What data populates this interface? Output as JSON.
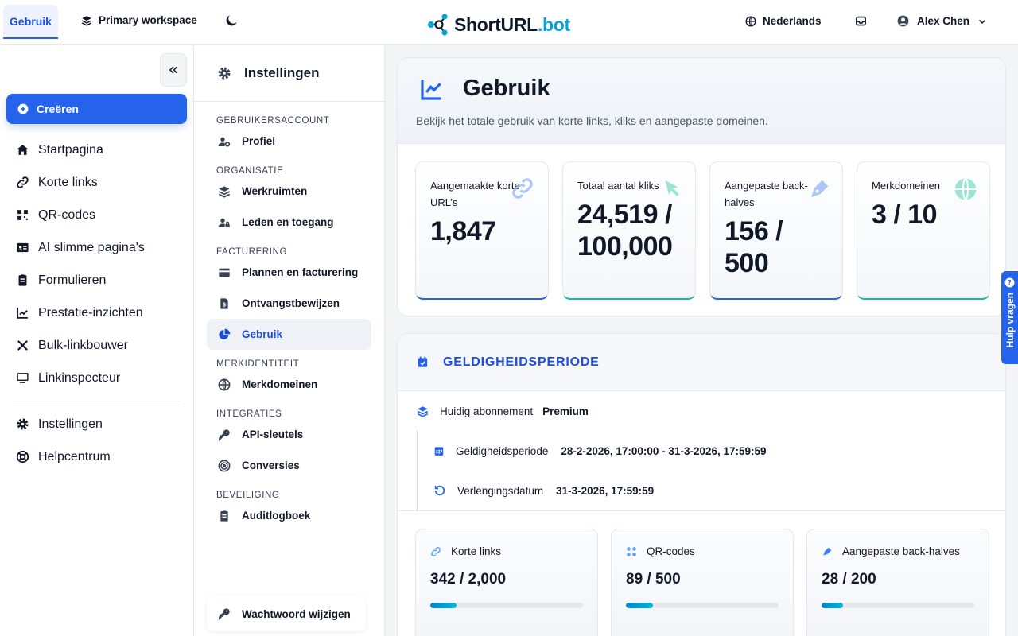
{
  "topbar": {
    "active_tab": "Gebruik",
    "workspace": "Primary workspace",
    "logo_main": "ShortURL",
    "logo_suffix": ".bot",
    "language": "Nederlands",
    "user_name": "Alex Chen"
  },
  "sidebar": {
    "create_label": "Creëren",
    "items": [
      {
        "label": "Startpagina",
        "icon": "home-icon"
      },
      {
        "label": "Korte links",
        "icon": "link-icon"
      },
      {
        "label": "QR-codes",
        "icon": "qr-icon"
      },
      {
        "label": "AI slimme pagina's",
        "icon": "id-card-icon"
      },
      {
        "label": "Formulieren",
        "icon": "clipboard-icon"
      },
      {
        "label": "Prestatie-inzichten",
        "icon": "chart-line-icon"
      },
      {
        "label": "Bulk-linkbouwer",
        "icon": "tools-icon"
      },
      {
        "label": "Linkinspecteur",
        "icon": "monitor-icon"
      }
    ],
    "bottom_items": [
      {
        "label": "Instellingen",
        "icon": "gear-icon"
      },
      {
        "label": "Helpcentrum",
        "icon": "lifebuoy-icon"
      }
    ]
  },
  "settings_nav": {
    "title": "Instellingen",
    "sections": [
      {
        "title": "GEBRUIKERSACCOUNT",
        "items": [
          "Profiel"
        ]
      },
      {
        "title": "ORGANISATIE",
        "items": [
          "Werkruimten",
          "Leden en toegang"
        ]
      },
      {
        "title": "FACTURERING",
        "items": [
          "Plannen en facturering",
          "Ontvangstbewijzen",
          "Gebruik"
        ]
      },
      {
        "title": "MERKIDENTITEIT",
        "items": [
          "Merkdomeinen"
        ]
      },
      {
        "title": "INTEGRATIES",
        "items": [
          "API-sleutels",
          "Conversies"
        ]
      },
      {
        "title": "BEVEILIGING",
        "items": [
          "Auditlogboek"
        ]
      }
    ],
    "active_item": "Gebruik",
    "change_password": "Wachtwoord wijzigen"
  },
  "usage": {
    "title": "Gebruik",
    "subtitle": "Bekijk het totale gebruik van korte links, kliks en aangepaste domeinen.",
    "stats": [
      {
        "label": "Aangemaakte korte URL’s",
        "value": "1,847",
        "accent": "#2563eb",
        "icon": "link-icon"
      },
      {
        "label": "Totaal aantal kliks",
        "value": "24,519 / 100,000",
        "accent": "#14b8a6",
        "icon": "cursor-icon"
      },
      {
        "label": "Aangepaste back-halves",
        "value": "156 / 500",
        "accent": "#2563eb",
        "icon": "pen-icon"
      },
      {
        "label": "Merkdomeinen",
        "value": "3 / 10",
        "accent": "#14b8a6",
        "icon": "globe-icon"
      }
    ]
  },
  "validity": {
    "title": "GELDIGHEIDSPERIODE",
    "plan_label": "Huidig abonnement",
    "plan_value": "Premium",
    "period_label": "Geldigheidsperiode",
    "period_value": "28-2-2026, 17:00:00 - 31-3-2026, 17:59:59",
    "renewal_label": "Verlengingsdatum",
    "renewal_value": "31-3-2026, 17:59:59",
    "limits": [
      {
        "label": "Korte links",
        "value": "342 / 2,000",
        "fraction": 0.171,
        "icon": "link-icon"
      },
      {
        "label": "QR-codes",
        "value": "89 / 500",
        "fraction": 0.178,
        "icon": "qr-icon"
      },
      {
        "label": "Aangepaste back-halves",
        "value": "28 / 200",
        "fraction": 0.14,
        "icon": "pen-icon"
      }
    ]
  },
  "help": {
    "label": "Hulp vragen"
  },
  "colors": {
    "primary": "#2563eb",
    "teal": "#14b8a6",
    "logo_accent": "#06a3d9"
  }
}
